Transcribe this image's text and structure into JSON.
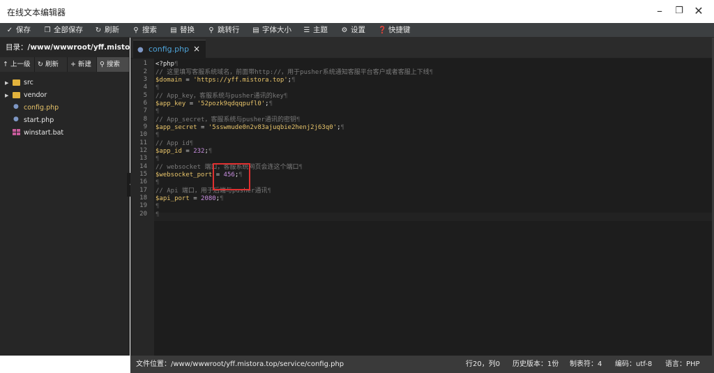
{
  "window": {
    "title": "在线文本编辑器",
    "minimize_icon": "minimize-icon",
    "maximize_icon": "maximize-icon",
    "close_icon": "close-icon"
  },
  "toolbar": {
    "save": "保存",
    "save_all": "全部保存",
    "refresh": "刷新",
    "search": "搜索",
    "replace": "替换",
    "goto_line": "跳转行",
    "font_size": "字体大小",
    "theme": "主题",
    "settings": "设置",
    "shortcuts": "快捷键"
  },
  "sidebar": {
    "dir_label": "目录：",
    "dir_path": "/www/wwwroot/yff.mistora.t...",
    "buttons": {
      "up": "上一级",
      "refresh": "刷新",
      "new": "新建",
      "search": "搜索"
    },
    "tree": [
      {
        "name": "src",
        "type": "folder"
      },
      {
        "name": "vendor",
        "type": "folder"
      },
      {
        "name": "config.php",
        "type": "php",
        "active": true
      },
      {
        "name": "start.php",
        "type": "php"
      },
      {
        "name": "winstart.bat",
        "type": "bat"
      }
    ]
  },
  "tabs": [
    {
      "label": "config.php",
      "close": "×"
    }
  ],
  "editor": {
    "line_numbers": [
      "1",
      "2",
      "3",
      "4",
      "5",
      "6",
      "7",
      "8",
      "9",
      "10",
      "11",
      "12",
      "13",
      "14",
      "15",
      "16",
      "17",
      "18",
      "19",
      "20"
    ],
    "lines": {
      "l1": "<?php",
      "l2": "// 这里填写客服系统域名，前面带http://，用于pusher系统通知客服平台客户或者客服上下线",
      "l3_var": "$domain",
      "l3_op": " = ",
      "l3_str": "'https://yff.mistora.top'",
      "l3_end": ";",
      "l5": "// App_key，客服系统与pusher通讯的key",
      "l6_var": "$app_key",
      "l6_op": " = ",
      "l6_str": "'52pozk9qdqqpufl0'",
      "l6_end": ";",
      "l8": "// App_secret，客服系统与pusher通讯的密钥",
      "l9_var": "$app_secret",
      "l9_op": " = ",
      "l9_str": "'5sswmude0n2v83ajuqbie2henj2j63q0'",
      "l9_end": ";",
      "l11": "// App id",
      "l12_var": "$app_id",
      "l12_op": " = ",
      "l12_num": "232",
      "l12_end": ";",
      "l14": "// websocket 端口，客服系统网页会连这个端口",
      "l15_var": "$websocket_port",
      "l15_op": " = ",
      "l15_num": "456",
      "l15_end": ";",
      "l17": "// Api 端口，用于后端与pusher通讯",
      "l18_var": "$api_port",
      "l18_op": " = ",
      "l18_num": "2080",
      "l18_end": ";"
    }
  },
  "statusbar": {
    "file_path": "文件位置：/www/wwwroot/yff.mistora.top/service/config.php",
    "cursor": "行20，列0",
    "history": "历史版本：1份",
    "tab_size": "制表符：4",
    "encoding": "编码：utf-8",
    "language": "语言：PHP"
  }
}
